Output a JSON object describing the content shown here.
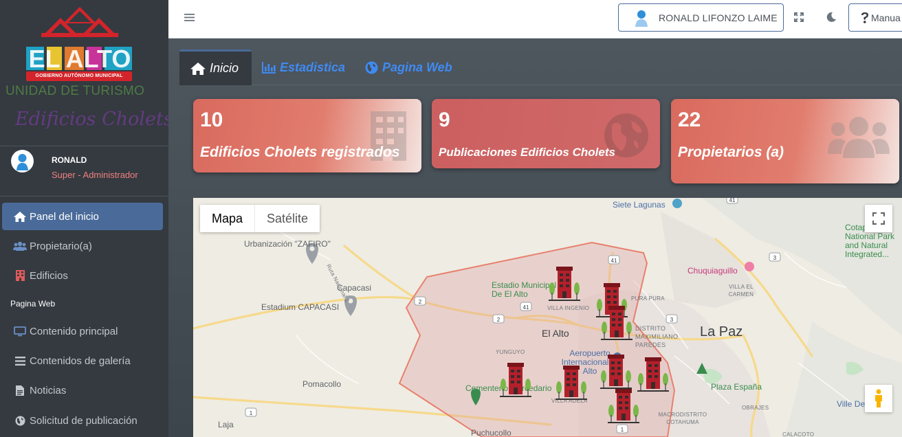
{
  "sidebar": {
    "logo_text": "EL ALTO",
    "logo_caption": "GOBIERNO AUTÓNOMO MUNICIPAL",
    "unit_title": "UNIDAD DE TURISMO",
    "unit_subtitle": "Edificios Cholets",
    "user": {
      "name": "RONALD",
      "role": "Super - Administrador"
    },
    "menu": [
      {
        "label": "Panel del inicio",
        "icon": "home-icon",
        "active": true
      },
      {
        "label": "Propietario(a)",
        "icon": "users-icon"
      },
      {
        "label": "Edificios",
        "icon": "building-icon"
      }
    ],
    "section_header": "Pagina Web",
    "web_menu": [
      {
        "label": "Contenido principal",
        "icon": "desktop-icon"
      },
      {
        "label": "Contenidos de galería",
        "icon": "bars-icon"
      },
      {
        "label": "Noticias",
        "icon": "file-icon"
      },
      {
        "label": "Solicitud de publicación",
        "icon": "globe-icon"
      }
    ]
  },
  "navbar": {
    "user_button": "RONALD LIFONZO LAIME",
    "manual_button": "Manua"
  },
  "tabs": [
    {
      "label": "Inicio",
      "icon": "home-icon",
      "active": true
    },
    {
      "label": "Estadistica",
      "icon": "chart-icon"
    },
    {
      "label": "Pagina Web",
      "icon": "globe-icon"
    }
  ],
  "cards": [
    {
      "value": "10",
      "label": "Edificios Cholets registrados",
      "icon": "building-icon"
    },
    {
      "value": "9",
      "label": "Publicaciones Edificios Cholets",
      "icon": "globe-icon"
    },
    {
      "value": "22",
      "label": "Propietarios (a)",
      "icon": "users-icon"
    }
  ],
  "map": {
    "type_buttons": {
      "map": "Mapa",
      "satellite": "Satélite"
    },
    "places": {
      "siete_lagunas": "Siete Lagunas",
      "zafiro": "Urbanización \"ZAFIRO\"",
      "ruta2": "Ruta Nacional 2",
      "capacasi": "Capacasi",
      "estadium": "Estadium CAPACASI",
      "estadio": "Estadio Municipal De El Alto",
      "villa_ingenio": "VILLA INGENIO",
      "el_alto": "El Alto",
      "yunguyo": "YUNGUYO",
      "aeropuerto": "Aeropuerto Internacional El Alto",
      "cementerio": "Cementerio Mercedario",
      "villa_adela": "VILLA ADELA",
      "pomacollo": "Pomacollo",
      "laja": "Laja",
      "puchucollo": "Puchucollo",
      "pura_pura": "PURA PURA",
      "max_paredes": "DISTRITO MAXIMILIANO PAREDES",
      "la_paz": "La Paz",
      "chuquiaguillo": "Chuquiaguillo",
      "villa_carmen": "VILLA EL CARMEN",
      "plaza_espana": "Plaza España",
      "obrajes": "OBRAJES",
      "macrodistrito": "MACRODISTRITO COTAHUMA",
      "calacoto": "CALACOTO",
      "villa_dewe": "Ville De",
      "cotapata": "Cotapata National Park and Natural Integrated..."
    },
    "road_shields": [
      "41",
      "3",
      "2",
      "41",
      "2",
      "3",
      "1",
      "1"
    ]
  }
}
